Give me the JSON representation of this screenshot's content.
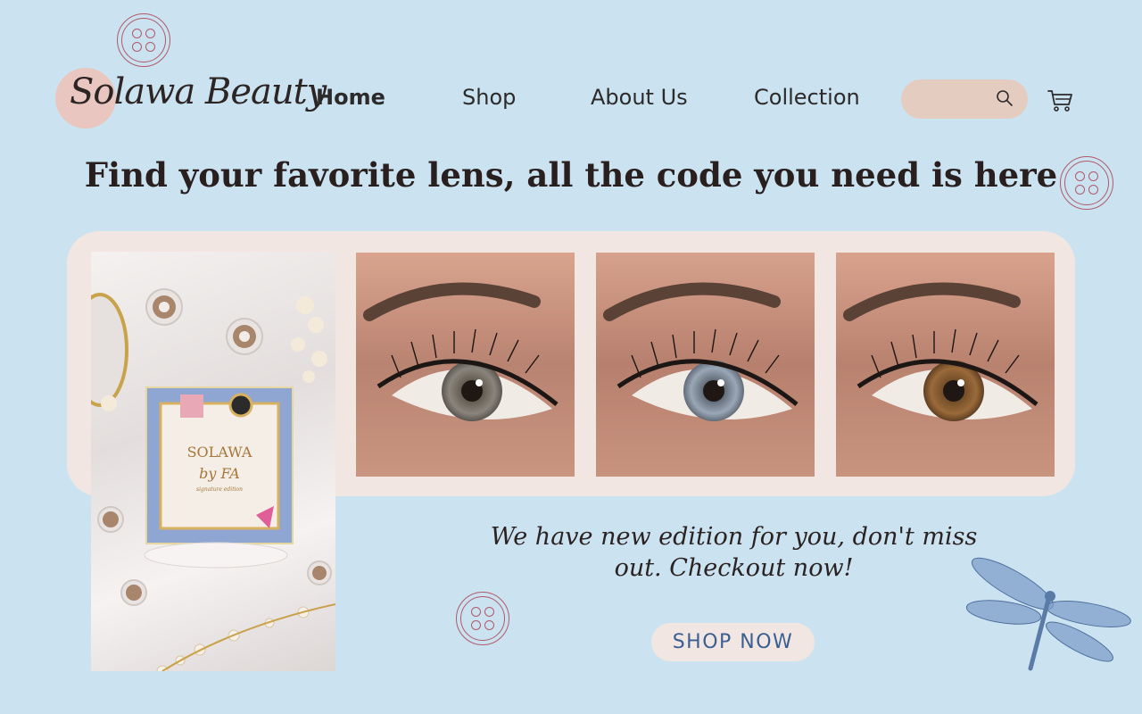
{
  "brand": {
    "logo_text": "Solawa Beauty"
  },
  "nav": {
    "items": [
      {
        "label": "Home",
        "active": true
      },
      {
        "label": "Shop",
        "active": false
      },
      {
        "label": "About Us",
        "active": false
      },
      {
        "label": "Collection",
        "active": false
      }
    ]
  },
  "search": {
    "placeholder": "",
    "icon": "search-icon"
  },
  "cart": {
    "icon": "cart-icon"
  },
  "hero": {
    "headline": "Find your favorite lens, all the code you need is here",
    "tagline_line1": "We have new edition for you, don't miss",
    "tagline_line2": "out. Checkout now!",
    "cta_label": "SHOP NOW"
  },
  "product_box": {
    "line1": "SOLAWA",
    "line2": "by FA",
    "line3": "signature edition"
  },
  "colors": {
    "background": "#cbe3f0",
    "panel": "#f2e6e2",
    "accent_pink": "#e9c7c0",
    "button_text": "#3a5f92",
    "deco": "#b05a6a"
  },
  "lens_colors": [
    "#8a857c",
    "#9aa7b6",
    "#9a6a3a"
  ]
}
